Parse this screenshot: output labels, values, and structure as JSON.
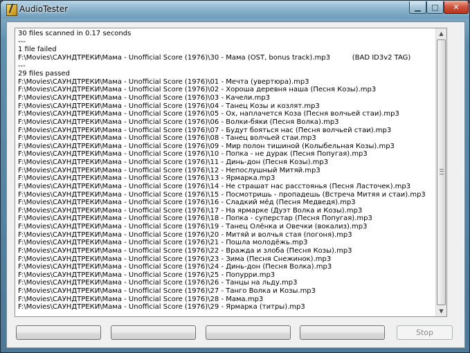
{
  "window": {
    "title": "AudioTester",
    "controls": {
      "minimize": "▁",
      "maximize": "□",
      "close": "✕"
    }
  },
  "log": {
    "lines": [
      "30 files scanned in 0.17 seconds",
      "---",
      "1 file failed",
      "F:\\Movies\\САУНДТРЕКИ\\Мама - Unofficial Score (1976)\\30 - Мама (OST, bonus track).mp3          (BAD ID3v2 TAG)",
      "---",
      "29 files passed",
      "F:\\Movies\\САУНДТРЕКИ\\Мама - Unofficial Score (1976)\\01 - Мечта (увертюра).mp3",
      "F:\\Movies\\САУНДТРЕКИ\\Мама - Unofficial Score (1976)\\02 - Хороша деревня наша (Песня Козы).mp3",
      "F:\\Movies\\САУНДТРЕКИ\\Мама - Unofficial Score (1976)\\03 - Качели.mp3",
      "F:\\Movies\\САУНДТРЕКИ\\Мама - Unofficial Score (1976)\\04 - Танец Козы и козлят.mp3",
      "F:\\Movies\\САУНДТРЕКИ\\Мама - Unofficial Score (1976)\\05 - Ох, наплачется Коза (Песня волчьей стаи).mp3",
      "F:\\Movies\\САУНДТРЕКИ\\Мама - Unofficial Score (1976)\\06 - Волки-бяки (Песня Волка).mp3",
      "F:\\Movies\\САУНДТРЕКИ\\Мама - Unofficial Score (1976)\\07 - Будут бояться нас (Песня волчьей стаи).mp3",
      "F:\\Movies\\САУНДТРЕКИ\\Мама - Unofficial Score (1976)\\08 - Танец волчьей стаи.mp3",
      "F:\\Movies\\САУНДТРЕКИ\\Мама - Unofficial Score (1976)\\09 - Мир полон тишиной (Колыбельная Козы).mp3",
      "F:\\Movies\\САУНДТРЕКИ\\Мама - Unofficial Score (1976)\\10 - Попка - не дурак (Песня Попугая).mp3",
      "F:\\Movies\\САУНДТРЕКИ\\Мама - Unofficial Score (1976)\\11 - Динь-дон (Песня Козы).mp3",
      "F:\\Movies\\САУНДТРЕКИ\\Мама - Unofficial Score (1976)\\12 - Непослушный Митяй.mp3",
      "F:\\Movies\\САУНДТРЕКИ\\Мама - Unofficial Score (1976)\\13 - Ярмарка.mp3",
      "F:\\Movies\\САУНДТРЕКИ\\Мама - Unofficial Score (1976)\\14 - Не страшат нас расстоянья (Песня Ласточек).mp3",
      "F:\\Movies\\САУНДТРЕКИ\\Мама - Unofficial Score (1976)\\15 - Посмотришь - пропадешь (Встреча Митяя и стаи).mp3",
      "F:\\Movies\\САУНДТРЕКИ\\Мама - Unofficial Score (1976)\\16 - Сладкий мёд (Песня Медведя).mp3",
      "F:\\Movies\\САУНДТРЕКИ\\Мама - Unofficial Score (1976)\\17 - На ярмарке (Дуэт Волка и Козы).mp3",
      "F:\\Movies\\САУНДТРЕКИ\\Мама - Unofficial Score (1976)\\18 - Попка - суперстар (Песня Попугая).mp3",
      "F:\\Movies\\САУНДТРЕКИ\\Мама - Unofficial Score (1976)\\19 - Танец Олёнка и Овечки (вокализ).mp3",
      "F:\\Movies\\САУНДТРЕКИ\\Мама - Unofficial Score (1976)\\20 - Митяй и волчья стая (погоня).mp3",
      "F:\\Movies\\САУНДТРЕКИ\\Мама - Unofficial Score (1976)\\21 - Пошла молодёжь.mp3",
      "F:\\Movies\\САУНДТРЕКИ\\Мама - Unofficial Score (1976)\\22 - Вражда и злоба (Песня Козы).mp3",
      "F:\\Movies\\САУНДТРЕКИ\\Мама - Unofficial Score (1976)\\23 - Зима (Песня Снежинок).mp3",
      "F:\\Movies\\САУНДТРЕКИ\\Мама - Unofficial Score (1976)\\24 - Динь-дон (Песня Волка).mp3",
      "F:\\Movies\\САУНДТРЕКИ\\Мама - Unofficial Score (1976)\\25 - Попурри.mp3",
      "F:\\Movies\\САУНДТРЕКИ\\Мама - Unofficial Score (1976)\\26 - Танцы на льду.mp3",
      "F:\\Movies\\САУНДТРЕКИ\\Мама - Unofficial Score (1976)\\27 - Танго Волка и Козы.mp3",
      "F:\\Movies\\САУНДТРЕКИ\\Мама - Unofficial Score (1976)\\28 - Мама.mp3",
      "F:\\Movies\\САУНДТРЕКИ\\Мама - Unofficial Score (1976)\\29 - Ярмарка (титры).mp3"
    ]
  },
  "scrollbar": {
    "up": "▲",
    "down": "▼"
  },
  "buttons": {
    "button_1": "",
    "button_2": "",
    "button_3": "",
    "button_4": "",
    "stop": "Stop"
  }
}
